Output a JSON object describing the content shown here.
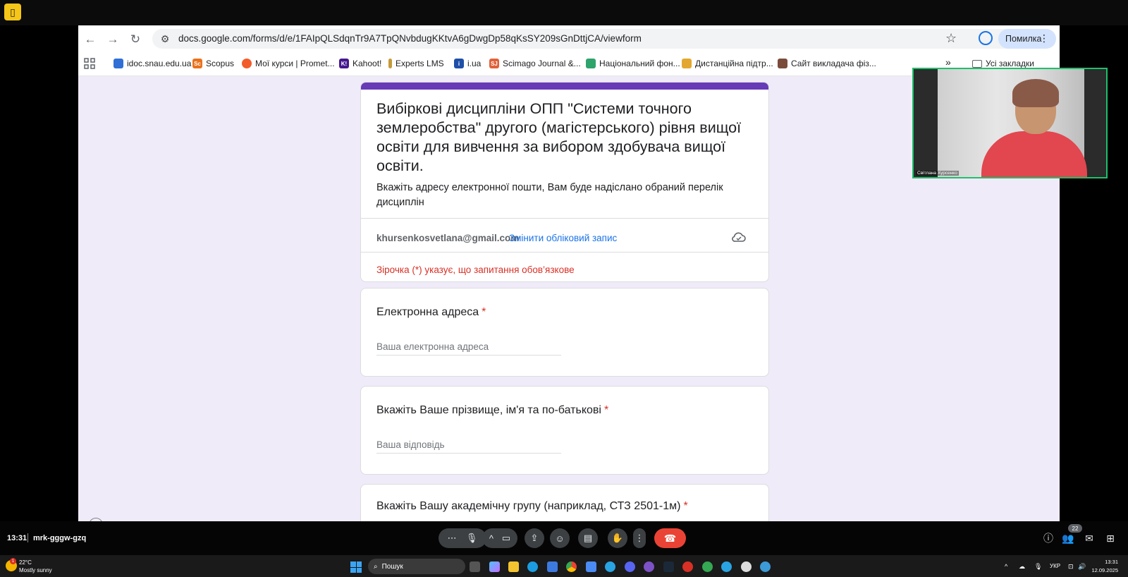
{
  "browser": {
    "url": "docs.google.com/forms/d/e/1FAIpQLSdqnTr9A7TpQNvbdugKKtvA6gDwgDp58qKsSY209sGnDttjCA/viewform",
    "error_label": "Помилка"
  },
  "bookmarks": [
    {
      "label": "idoc.snau.edu.ua",
      "icon": "idoc-icon",
      "color": "#2f6fd6"
    },
    {
      "label": "Scopus",
      "icon": "scopus-icon",
      "color": "#e9711c"
    },
    {
      "label": "Мої курси | Promet...",
      "icon": "prometheus-icon",
      "color": "#f25c2a"
    },
    {
      "label": "Kahoot!",
      "icon": "kahoot-icon",
      "color": "#46178f"
    },
    {
      "label": "Experts LMS",
      "icon": "experts-icon",
      "color": "#c49a3b"
    },
    {
      "label": "i.ua",
      "icon": "iua-icon",
      "color": "#1f4fa8"
    },
    {
      "label": "Scimago Journal &...",
      "icon": "scimago-icon",
      "color": "#e0623a"
    },
    {
      "label": "Національний фон...",
      "icon": "nrfu-icon",
      "color": "#2ea36b"
    },
    {
      "label": "Дистанційна підтр...",
      "icon": "distance-icon",
      "color": "#e3a72f"
    },
    {
      "label": "Сайт викладача фіз...",
      "icon": "teacher-site-icon",
      "color": "#7a4b3a"
    }
  ],
  "all_bookmarks_label": "Усі закладки",
  "form": {
    "title": "Вибіркові дисципліни ОПП \"Системи точного землеробства\" другого (магістерського) рівня вищої освіти для вивчення за вибором здобувача вищої освіти.",
    "description": "Вкажіть адресу електронної пошти, Вам буде надіслано обраний перелік дисциплін",
    "account_email": "khursenkosvetlana@gmail.com",
    "switch_account": "Змінити обліковий запис",
    "required_note": "Зірочка (*) указує, що запитання обов’язкове",
    "questions": [
      {
        "title": "Електронна адреса",
        "placeholder": "Ваша електронна адреса"
      },
      {
        "title": "Вкажіть Ваше прізвище, ім'я та по-батькові",
        "placeholder": "Ваша відповідь"
      },
      {
        "title": "Вкажіть Вашу академічну групу (наприклад, СТЗ 2501-1м)",
        "placeholder": ""
      }
    ],
    "required_mark": "*"
  },
  "video": {
    "participant_name": "Світлана Хурсенко"
  },
  "meet": {
    "time": "13:31",
    "code": "mrk-gggw-gzq",
    "participants_count": "22"
  },
  "taskbar": {
    "weather_temp": "22°C",
    "weather_cond": "Mostly sunny",
    "weather_badge": "1",
    "search_label": "Пошук",
    "lang": "УКР",
    "time": "13:31",
    "date": "12.09.2025"
  },
  "colors": {
    "accent": "#673ab7",
    "link": "#1a73e8",
    "required": "#d93025",
    "end_call": "#ea4335"
  }
}
